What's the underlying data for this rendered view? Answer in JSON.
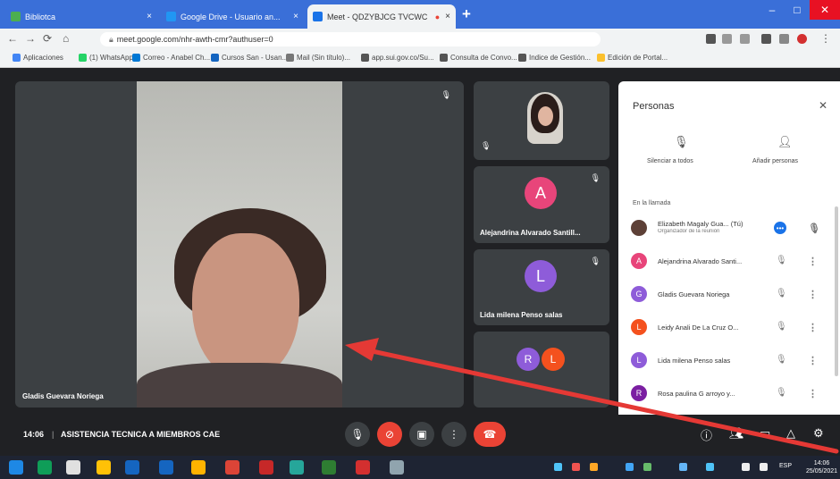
{
  "browser": {
    "tabs": [
      {
        "label": "Bibliotca",
        "favicon_color": "#4caf50",
        "active": false
      },
      {
        "label": "Google Drive - Usuario an...",
        "favicon_color": "#2196f3",
        "active": false
      },
      {
        "label": "Meet - QDZYBJCG TVCWC",
        "favicon_color": "#1a73e8",
        "active": true
      }
    ],
    "url": "meet.google.com/nhr-awth-cmr?authuser=0",
    "bookmarks": [
      "Aplicaciones",
      "(1) WhatsApp",
      "Correo - Anabel Ch...",
      "Cursos San - Usan...",
      "Mail (Sin título)...",
      "app.sui.gov.co/Su...",
      "Consulta de Convo...",
      "Indice de Gestión...",
      "Edición de Portal..."
    ]
  },
  "meet": {
    "main_participant": "Gladis Guevara Noriega",
    "side_tiles": [
      {
        "name": "",
        "avatar_letter": "",
        "avatar_color": "",
        "kind": "video"
      },
      {
        "name": "Alejandrina Alvarado Santill...",
        "avatar_letter": "A",
        "avatar_color": "#e8457a",
        "kind": "avatar"
      },
      {
        "name": "Lida milena Penso salas",
        "avatar_letter": "L",
        "avatar_color": "#8e5cd9",
        "kind": "avatar"
      },
      {
        "name": "",
        "avatar_letter": "",
        "avatar_color": "",
        "kind": "group"
      }
    ],
    "group_avatars": [
      {
        "letter": "R",
        "color": "#8e5cd9"
      },
      {
        "letter": "L",
        "color": "#f4511e"
      }
    ],
    "time": "14:06",
    "separator": "|",
    "meeting_title": "ASISTENCIA TECNICA A MIEMBROS CAE"
  },
  "people_panel": {
    "title": "Personas",
    "action_mute_all": "Silenciar a todos",
    "action_add": "Añadir personas",
    "section_label": "En la llamada",
    "participants": [
      {
        "name": "Elizabeth Magaly Gua... (Tú)",
        "avatar_letter": "",
        "avatar_color": "#5d4037",
        "sub": "Organizador de la reunión"
      },
      {
        "name": "Alejandrina Alvarado Santi...",
        "avatar_letter": "A",
        "avatar_color": "#e8457a"
      },
      {
        "name": "Gladis Guevara Noriega",
        "avatar_letter": "G",
        "avatar_color": "#8e5cd9"
      },
      {
        "name": "Leidy Anali De La Cruz O...",
        "avatar_letter": "L",
        "avatar_color": "#f4511e"
      },
      {
        "name": "Lida milena Penso salas",
        "avatar_letter": "L",
        "avatar_color": "#8e5cd9"
      },
      {
        "name": "Rosa paulina G arroyo y...",
        "avatar_letter": "R",
        "avatar_color": "#7b1fa2"
      }
    ]
  },
  "taskbar": {
    "app_colors": [
      "#1e88e5",
      "#0f9d58",
      "#e0e0e0",
      "#ffc107",
      "#1565c0",
      "#ffb300",
      "#db4437",
      "#c62828",
      "#26a69a",
      "#2e7d32",
      "#d32f2f",
      "#90a4ae"
    ],
    "clock_time": "14:06",
    "clock_date": "25/05/2021",
    "language": "ESP"
  },
  "annotation": {
    "arrow_color": "#e53935"
  }
}
